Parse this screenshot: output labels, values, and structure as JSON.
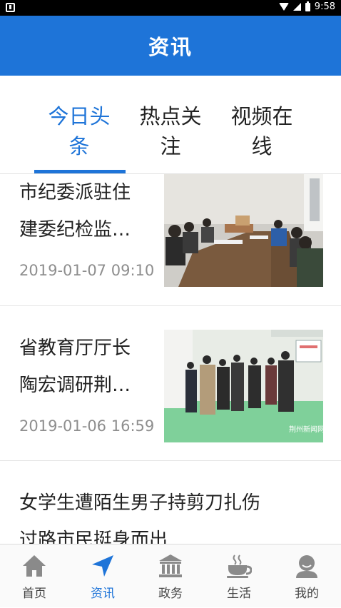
{
  "status_bar": {
    "time": "9:58"
  },
  "app_bar": {
    "title": "资讯"
  },
  "tabs": [
    {
      "label_line1": "今日头",
      "label_line2": "条",
      "active": true
    },
    {
      "label_line1": "热点关",
      "label_line2": "注",
      "active": false
    },
    {
      "label_line1": "视频在",
      "label_line2": "线",
      "active": false
    }
  ],
  "news": [
    {
      "title_line1": "市纪委派驻住",
      "title_line2": "建委纪检监…",
      "date": "2019-01-07 09:10",
      "thumb_icon": "meeting-photo"
    },
    {
      "title_line1": "省教育厅厅长",
      "title_line2": "陶宏调研荆…",
      "date": "2019-01-06 16:59",
      "thumb_icon": "visit-photo",
      "watermark": "荆州新闻网"
    },
    {
      "title_line1": "女学生遭陌生男子持剪刀扎伤",
      "title_line2": "过路市民挺身而出"
    }
  ],
  "bottom_nav": [
    {
      "label": "首页",
      "icon": "home-icon",
      "active": false
    },
    {
      "label": "资讯",
      "icon": "navigation-arrow-icon",
      "active": true
    },
    {
      "label": "政务",
      "icon": "government-building-icon",
      "active": false
    },
    {
      "label": "生活",
      "icon": "coffee-cup-icon",
      "active": false
    },
    {
      "label": "我的",
      "icon": "user-icon",
      "active": false
    }
  ],
  "colors": {
    "accent": "#1e74d8",
    "inactive_icon": "#8a8a8a"
  }
}
